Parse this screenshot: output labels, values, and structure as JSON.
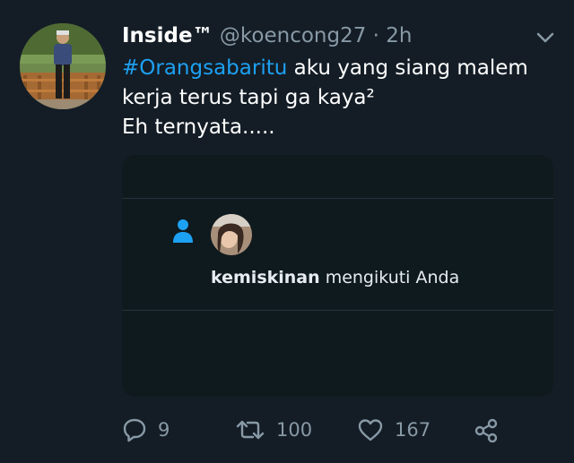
{
  "tweet": {
    "display_name": "Inside™",
    "handle": "@koencong27",
    "separator": "·",
    "time": "2h",
    "hashtag": "#Orangsabaritu",
    "text_line1": " aku yang siang malem",
    "text_line2": "kerja terus tapi ga kaya²",
    "text_line3": "Eh ternyata....."
  },
  "card": {
    "notif_user": "kemiskinan",
    "notif_action": " mengikuti Anda"
  },
  "actions": {
    "reply_count": "9",
    "retweet_count": "100",
    "like_count": "167"
  },
  "icons": {
    "reply": "reply-icon",
    "retweet": "retweet-icon",
    "like": "heart-icon",
    "share": "share-icon",
    "menu": "chevron-down-icon",
    "follow": "person-icon"
  },
  "colors": {
    "background": "#141d26",
    "link": "#1da1f2",
    "muted": "#8899a6",
    "card_bg": "#0f1a1e"
  }
}
